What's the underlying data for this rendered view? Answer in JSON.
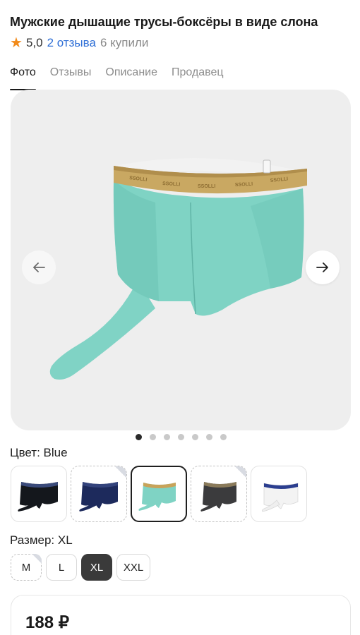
{
  "product": {
    "title": "Мужские дышащие трусы-боксёры в виде слона",
    "rating": "5,0",
    "reviews_link": "2 отзыва",
    "bought": "6 купили"
  },
  "tabs": [
    {
      "label": "Фото",
      "active": true
    },
    {
      "label": "Отзывы",
      "active": false
    },
    {
      "label": "Описание",
      "active": false
    },
    {
      "label": "Продавец",
      "active": false
    }
  ],
  "gallery": {
    "images_count": 7,
    "active_index": 0,
    "icons": {
      "prev": "arrow-left-icon",
      "next": "arrow-right-icon"
    },
    "product_color": "#7fd3c4"
  },
  "color": {
    "label": "Цвет: Blue",
    "options": [
      {
        "color": "#15181d",
        "band": "#3a4a7a"
      },
      {
        "color": "#1e2a5a",
        "band": "#2f3e78"
      },
      {
        "color": "#7fd3c4",
        "band": "#c8a35a"
      },
      {
        "color": "#3a3a3c",
        "band": "#8a7a5a"
      },
      {
        "color": "#f4f4f4",
        "band": "#2b3e8f"
      }
    ],
    "selected_index": 2
  },
  "size": {
    "label": "Размер: XL",
    "options": [
      "M",
      "L",
      "XL",
      "XXL"
    ],
    "selected_index": 2
  },
  "price": "188 ₽"
}
